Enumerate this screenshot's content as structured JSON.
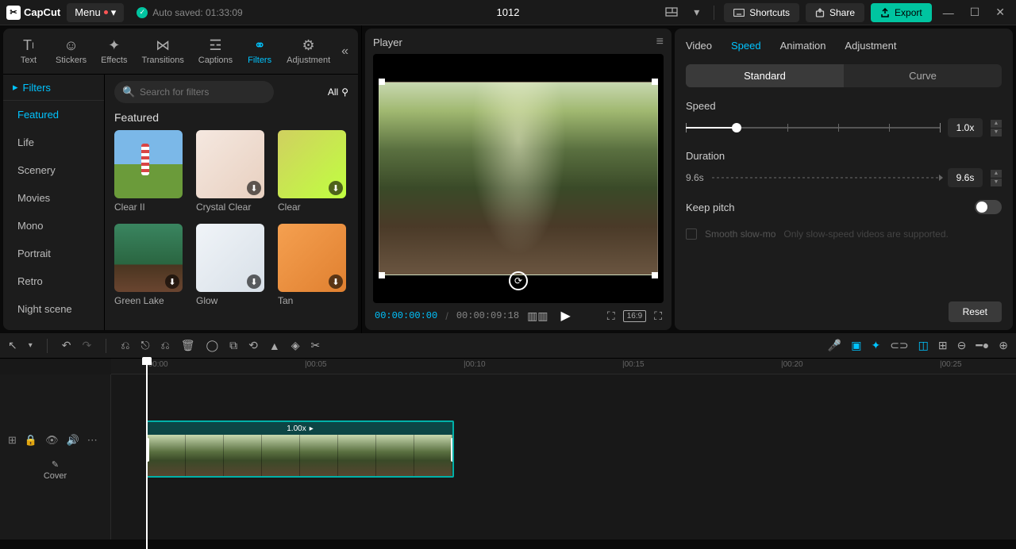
{
  "app": {
    "name": "CapCut",
    "menu": "Menu"
  },
  "autosave": {
    "text": "Auto saved: 01:33:09"
  },
  "project_title": "1012",
  "titlebar": {
    "shortcuts": "Shortcuts",
    "share": "Share",
    "export": "Export"
  },
  "media_tabs": [
    "Text",
    "Stickers",
    "Effects",
    "Transitions",
    "Captions",
    "Filters",
    "Adjustment"
  ],
  "filters_dropdown": "Filters",
  "filter_categories": [
    "Featured",
    "Life",
    "Scenery",
    "Movies",
    "Mono",
    "Portrait",
    "Retro",
    "Night scene"
  ],
  "search": {
    "placeholder": "Search for filters",
    "all": "All"
  },
  "section_title": "Featured",
  "filter_items": [
    "Clear II",
    "Crystal Clear",
    "Clear",
    "Green Lake",
    "Glow",
    "Tan"
  ],
  "player": {
    "title": "Player",
    "current": "00:00:00:00",
    "total": "00:00:09:18",
    "ratio": "16:9"
  },
  "right_tabs": [
    "Video",
    "Speed",
    "Animation",
    "Adjustment"
  ],
  "speed": {
    "toggle": {
      "standard": "Standard",
      "curve": "Curve"
    },
    "label": "Speed",
    "value": "1.0x",
    "duration_label": "Duration",
    "duration_left": "9.6s",
    "duration_value": "9.6s",
    "keep_pitch": "Keep pitch",
    "smooth_label": "Smooth slow-mo",
    "smooth_hint": "Only slow-speed videos are supported.",
    "reset": "Reset"
  },
  "clip": {
    "speed_display": "1.00x"
  },
  "cover": "Cover",
  "ruler": [
    "|00:00",
    "|00:05",
    "|00:10",
    "|00:15",
    "|00:20",
    "|00:25"
  ]
}
